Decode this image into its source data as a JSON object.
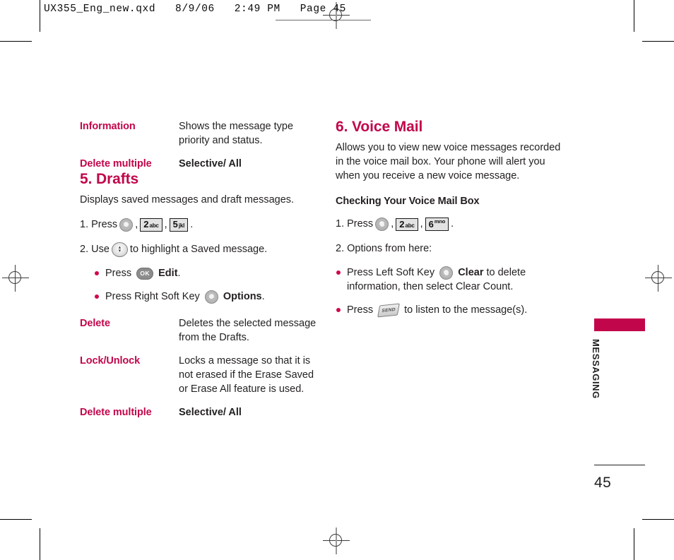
{
  "print_marks": {
    "slug": "UX355_Eng_new.qxd   8/9/06   2:49 PM   Page 45"
  },
  "left_column": {
    "top_definitions": [
      {
        "term": "Information",
        "desc": "Shows the message type priority and status.",
        "bold": false
      },
      {
        "term": "Delete multiple",
        "desc": "Selective/ All",
        "bold": true
      }
    ],
    "section": {
      "heading": "5. Drafts",
      "intro": "Displays saved messages and draft messages.",
      "step1_prefix": "1. Press",
      "step1_sep": ",",
      "step1_end": ".",
      "step1_keys": [
        {
          "type": "round",
          "name": "center-key"
        },
        {
          "type": "num",
          "digit": "2",
          "letters": "abc"
        },
        {
          "type": "num",
          "digit": "5",
          "letters": "jkl"
        }
      ],
      "step2_prefix": "2. Use",
      "step2_suffix": "to highlight a Saved message.",
      "bullets": [
        {
          "pre": "Press",
          "key": "ok-key",
          "key_label": "OK",
          "bold_text": "Edit",
          "post": "."
        },
        {
          "pre": "Press Right Soft Key",
          "key": "soft-key",
          "bold_text": "Options",
          "post": "."
        }
      ]
    },
    "bottom_definitions": [
      {
        "term": "Delete",
        "desc": "Deletes the selected message from the Drafts.",
        "bold": false
      },
      {
        "term": "Lock/Unlock",
        "desc": "Locks a message so that it is not erased if the Erase Saved or Erase All feature is used.",
        "bold": false
      },
      {
        "term": "Delete multiple",
        "desc": "Selective/ All",
        "bold": true
      }
    ]
  },
  "right_column": {
    "heading": "6. Voice Mail",
    "intro": "Allows you to view new voice messages recorded in the voice mail box. Your phone will alert you when you receive a new voice message.",
    "subhead": "Checking Your Voice Mail Box",
    "step1_prefix": "1. Press",
    "step1_sep": ",",
    "step1_end": ".",
    "step1_keys": [
      {
        "type": "round",
        "name": "center-key"
      },
      {
        "type": "num",
        "digit": "2",
        "letters": "abc"
      },
      {
        "type": "num",
        "digit": "6",
        "letters": "mno"
      }
    ],
    "step2": "2. Options from here:",
    "bullets": [
      {
        "pre": "Press Left Soft Key",
        "key": "soft-key",
        "bold_text": "Clear",
        "post": "to delete information,  then select Clear Count."
      },
      {
        "pre": "Press",
        "key": "send-key",
        "key_label": "SEND",
        "post": "to listen to the message(s)."
      }
    ]
  },
  "side_tab": {
    "label": "MESSAGING",
    "color": "#c2064b"
  },
  "folio": {
    "page_number": "45"
  }
}
